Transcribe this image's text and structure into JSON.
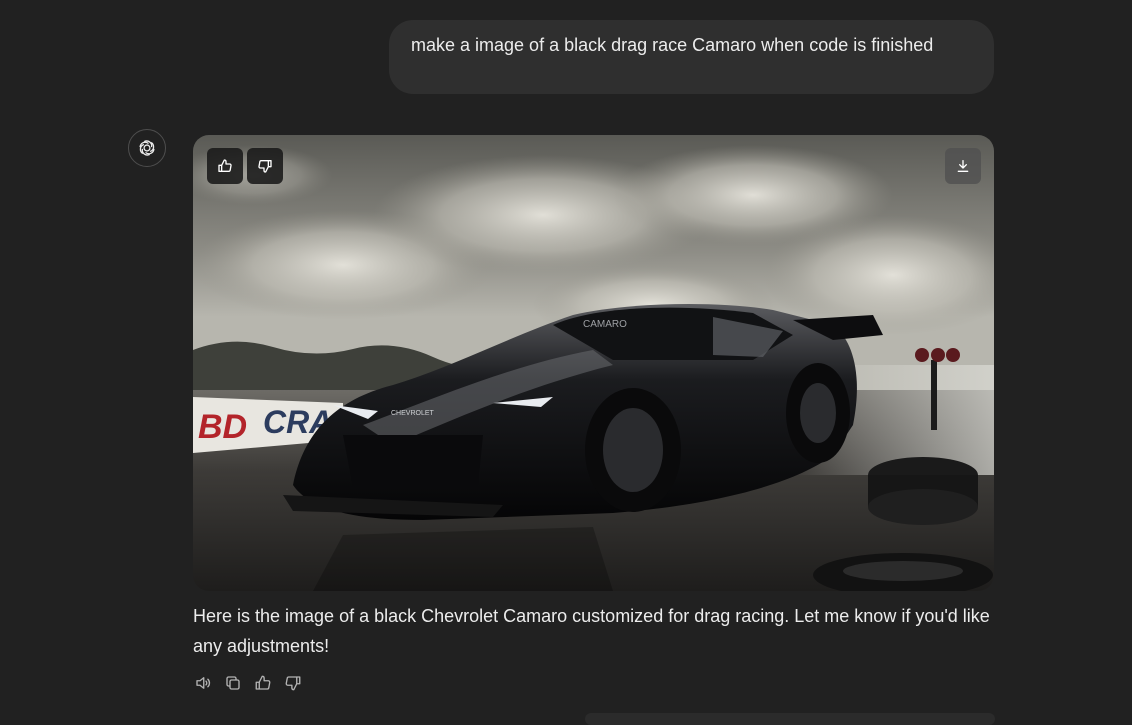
{
  "user_message": {
    "text": "make a image of a black drag race Camaro when code is finished"
  },
  "assistant": {
    "avatar_icon": "openai-logo-icon",
    "image": {
      "description_icon": "generated-image-camaro",
      "overlay_buttons": {
        "like_icon": "thumbs-up-icon",
        "dislike_icon": "thumbs-down-icon",
        "download_icon": "download-icon"
      },
      "scene_text": {
        "banner_left": "BD",
        "banner_right": "CRA",
        "windshield": "CAMARO",
        "grille_badge": "CHEVROLET"
      }
    },
    "response_text": "Here is the image of a black Chevrolet Camaro customized for drag racing. Let me know if you'd like any adjustments!",
    "actions": {
      "read_aloud_icon": "speaker-icon",
      "copy_icon": "copy-icon",
      "like_icon": "thumbs-up-icon",
      "dislike_icon": "thumbs-down-icon"
    }
  },
  "colors": {
    "background": "#212121",
    "bubble": "#2f2f2f",
    "text": "#ececec",
    "icon": "#b4b4b4"
  }
}
